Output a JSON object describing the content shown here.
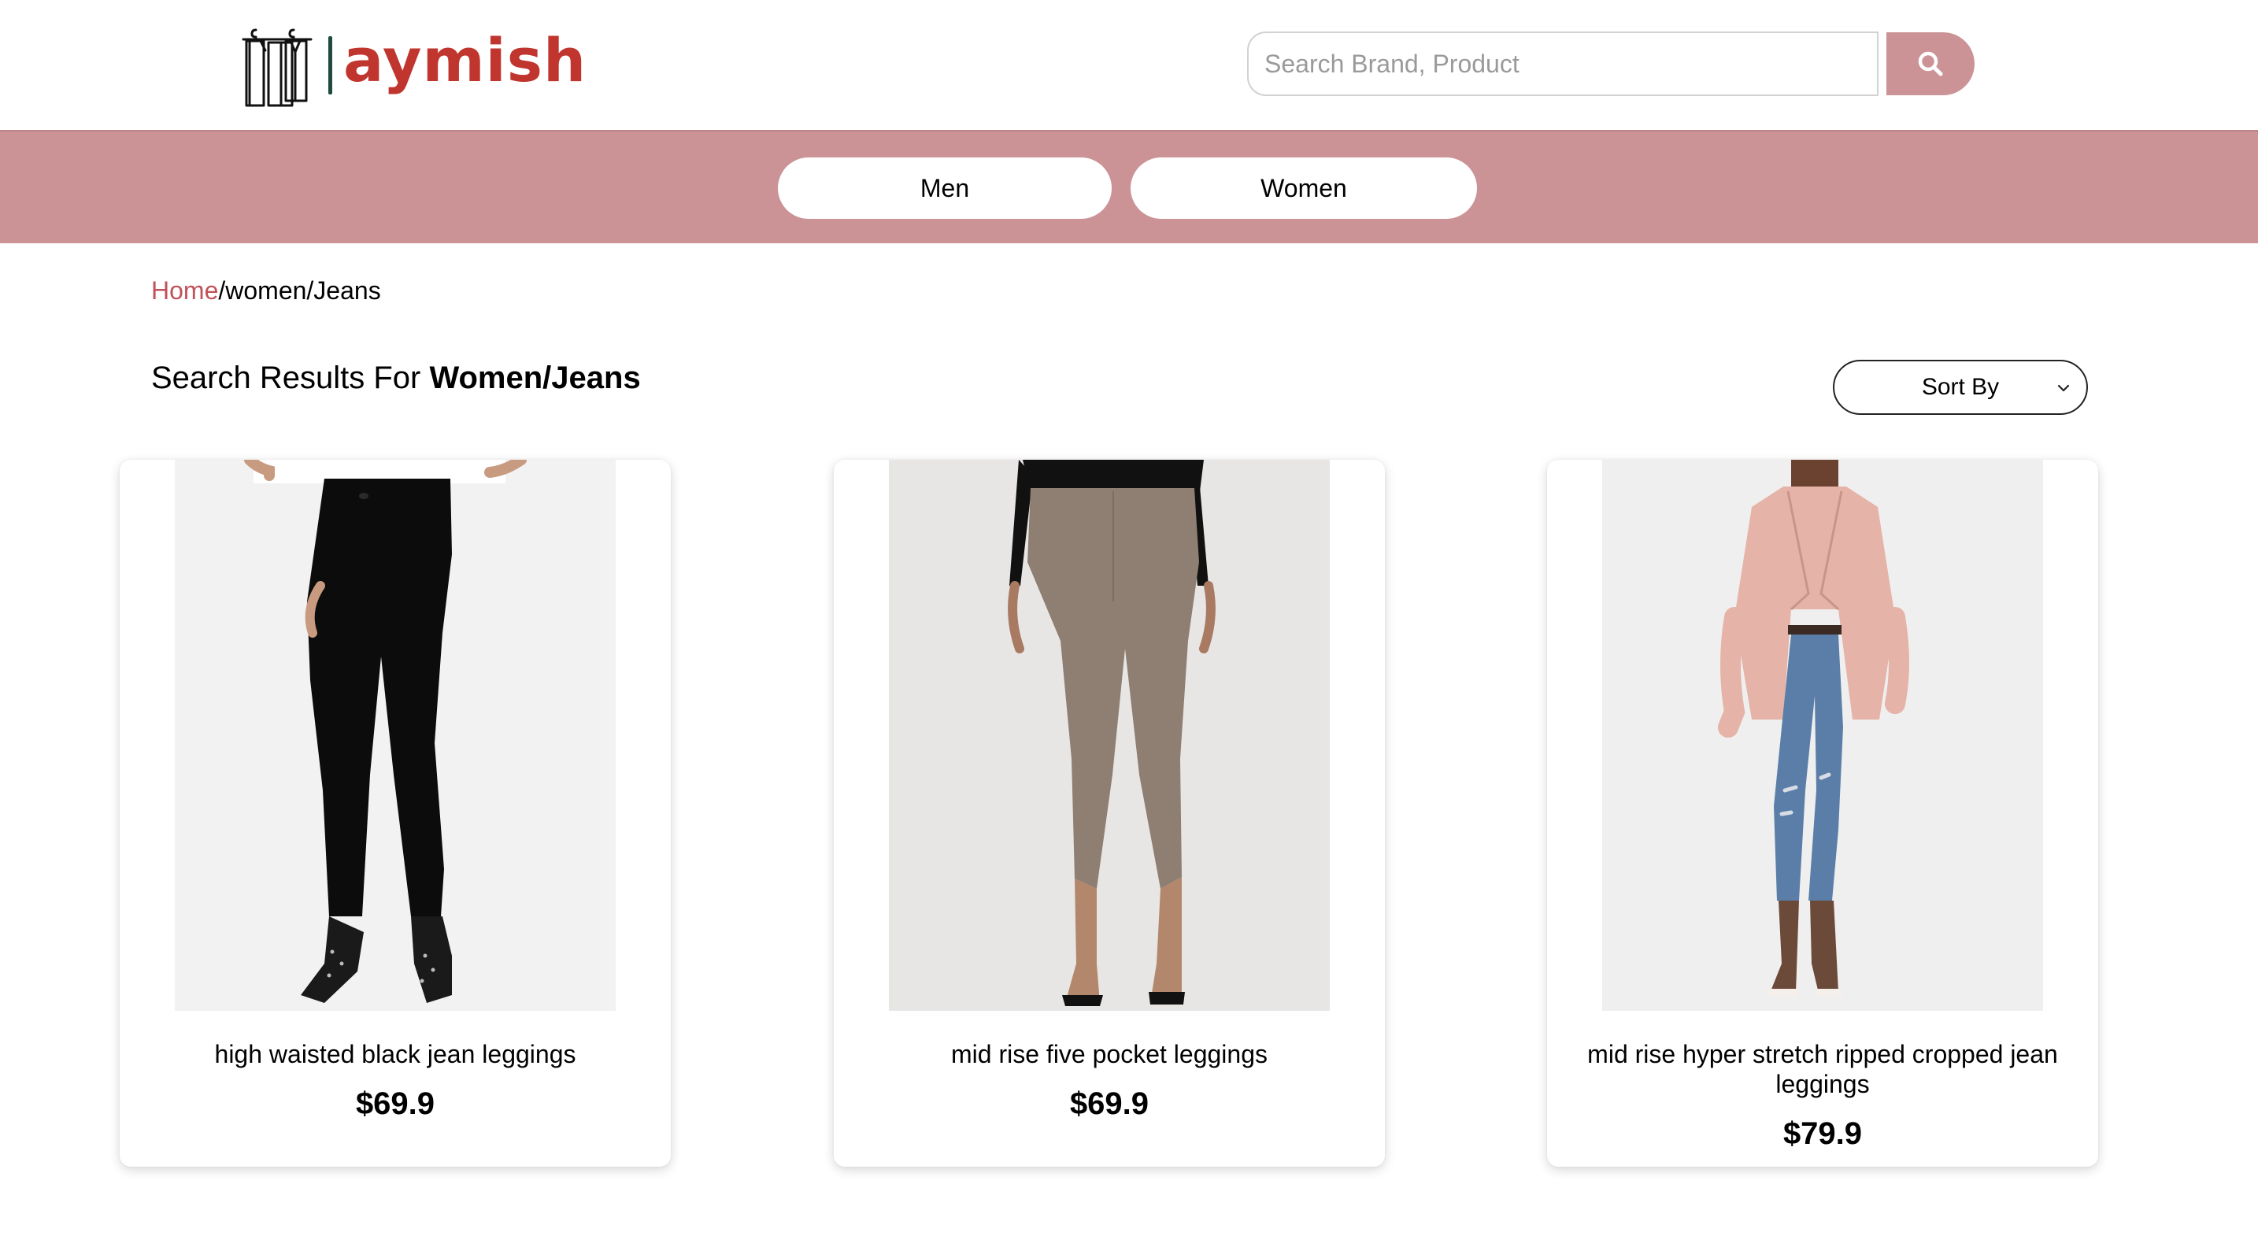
{
  "header": {
    "logo_text": "aymish",
    "search_placeholder": "Search Brand, Product",
    "search_value": "",
    "search_button_icon": "search-icon"
  },
  "nav": {
    "items": [
      {
        "label": "Men"
      },
      {
        "label": "Women"
      }
    ]
  },
  "breadcrumb": {
    "home": "Home",
    "rest": "/women/Jeans"
  },
  "results": {
    "prefix": "Search Results For ",
    "query": "Women/Jeans"
  },
  "sort": {
    "label": "Sort By",
    "icon": "chevron-down-icon"
  },
  "products": [
    {
      "name": "high waisted black jean leggings",
      "price": "$69.9",
      "image": "model-black-jeans"
    },
    {
      "name": "mid rise five pocket leggings",
      "price": "$69.9",
      "image": "model-taupe-leggings"
    },
    {
      "name": "mid rise hyper stretch ripped cropped jean leggings",
      "price": "$79.9",
      "image": "model-blazer-ripped-jeans"
    }
  ],
  "colors": {
    "brand_red": "#c0352d",
    "accent_pink": "#cc9396",
    "breadcrumb_link": "#c0525a",
    "logo_divider": "#1f4a40"
  }
}
